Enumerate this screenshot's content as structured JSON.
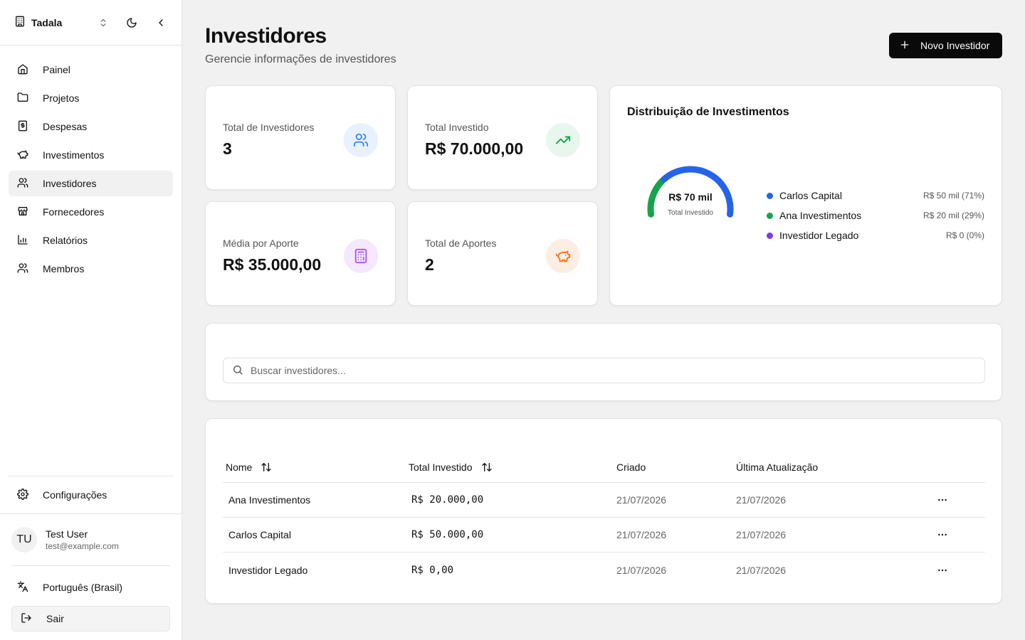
{
  "sidebar": {
    "org_name": "Tadala",
    "items": [
      {
        "label": "Painel",
        "icon": "home-icon"
      },
      {
        "label": "Projetos",
        "icon": "folder-icon"
      },
      {
        "label": "Despesas",
        "icon": "receipt-icon"
      },
      {
        "label": "Investimentos",
        "icon": "piggy-bank-icon"
      },
      {
        "label": "Investidores",
        "icon": "users-icon",
        "active": true
      },
      {
        "label": "Fornecedores",
        "icon": "store-icon"
      },
      {
        "label": "Relatórios",
        "icon": "bar-chart-icon"
      },
      {
        "label": "Membros",
        "icon": "users-icon"
      }
    ],
    "settings_label": "Configurações",
    "user": {
      "initials": "TU",
      "name": "Test User",
      "email": "test@example.com"
    },
    "language_label": "Português (Brasil)",
    "logout_label": "Sair"
  },
  "header": {
    "title": "Investidores",
    "subtitle": "Gerencie informações de investidores",
    "new_button_label": "Novo Investidor"
  },
  "stats": [
    {
      "label": "Total de Investidores",
      "value": "3",
      "icon": "users-icon",
      "color": "#3b82f6",
      "bg": "#e8f1fe"
    },
    {
      "label": "Total Investido",
      "value": "R$ 70.000,00",
      "icon": "trending-up-icon",
      "color": "#16a34a",
      "bg": "#e7f7ee"
    },
    {
      "label": "Média por Aporte",
      "value": "R$ 35.000,00",
      "icon": "calculator-icon",
      "color": "#a855f7",
      "bg": "#f5e8fd"
    },
    {
      "label": "Total de Aportes",
      "value": "2",
      "icon": "piggy-bank-icon",
      "color": "#f97316",
      "bg": "#fdeee3"
    }
  ],
  "distribution": {
    "title": "Distribuição de Investimentos",
    "center_value": "R$ 70 mil",
    "center_label": "Total Investido",
    "legend": [
      {
        "name": "Carlos Capital",
        "value": "R$ 50 mil (71%)",
        "color": "#2563eb"
      },
      {
        "name": "Ana Investimentos",
        "value": "R$ 20 mil (29%)",
        "color": "#16a34a"
      },
      {
        "name": "Investidor Legado",
        "value": "R$ 0 (0%)",
        "color": "#7c3aed"
      }
    ],
    "shares": [
      0.2857,
      0.7143
    ]
  },
  "search": {
    "placeholder": "Buscar investidores..."
  },
  "table": {
    "headers": {
      "name": "Nome",
      "total": "Total Investido",
      "created": "Criado",
      "updated": "Última Atualização"
    },
    "rows": [
      {
        "name": "Ana Investimentos",
        "total": "R$ 20.000,00",
        "created": "21/07/2026",
        "updated": "21/07/2026"
      },
      {
        "name": "Carlos Capital",
        "total": "R$ 50.000,00",
        "created": "21/07/2026",
        "updated": "21/07/2026"
      },
      {
        "name": "Investidor Legado",
        "total": "R$ 0,00",
        "created": "21/07/2026",
        "updated": "21/07/2026"
      }
    ]
  }
}
